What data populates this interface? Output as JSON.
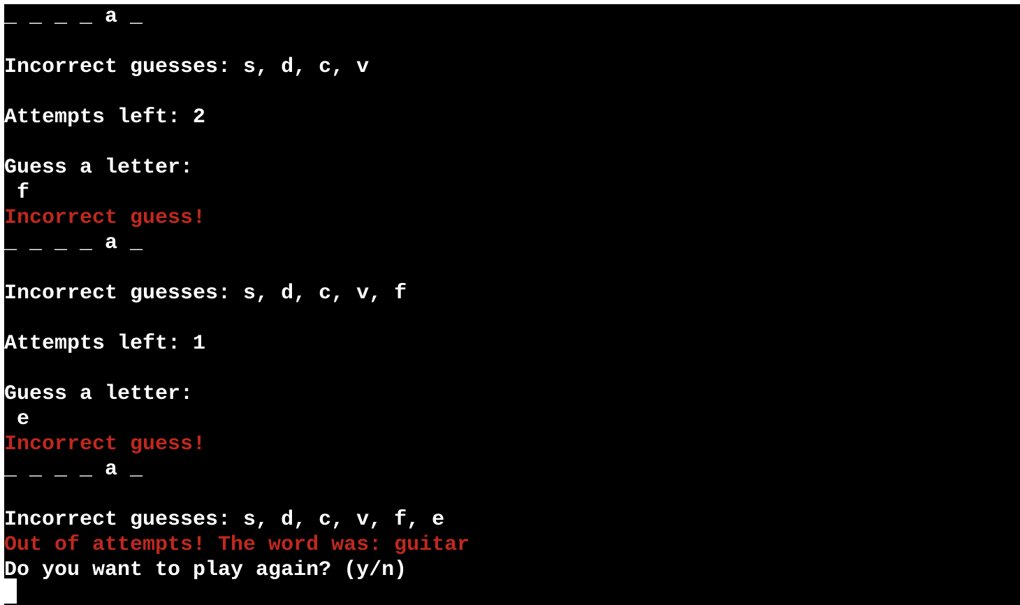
{
  "terminal": {
    "lines": [
      {
        "text": "_ _ _ _ a _",
        "kind": "normal"
      },
      {
        "text": "",
        "kind": "blank"
      },
      {
        "text": "Incorrect guesses: s, d, c, v",
        "kind": "normal"
      },
      {
        "text": "",
        "kind": "blank"
      },
      {
        "text": "Attempts left: 2",
        "kind": "normal"
      },
      {
        "text": "",
        "kind": "blank"
      },
      {
        "text": "Guess a letter:",
        "kind": "normal"
      },
      {
        "text": " f",
        "kind": "input"
      },
      {
        "text": "Incorrect guess!",
        "kind": "error"
      },
      {
        "text": "_ _ _ _ a _",
        "kind": "normal"
      },
      {
        "text": "",
        "kind": "blank"
      },
      {
        "text": "Incorrect guesses: s, d, c, v, f",
        "kind": "normal"
      },
      {
        "text": "",
        "kind": "blank"
      },
      {
        "text": "Attempts left: 1",
        "kind": "normal"
      },
      {
        "text": "",
        "kind": "blank"
      },
      {
        "text": "Guess a letter:",
        "kind": "normal"
      },
      {
        "text": " e",
        "kind": "input"
      },
      {
        "text": "Incorrect guess!",
        "kind": "error"
      },
      {
        "text": "_ _ _ _ a _",
        "kind": "normal"
      },
      {
        "text": "",
        "kind": "blank"
      },
      {
        "text": "Incorrect guesses: s, d, c, v, f, e",
        "kind": "normal"
      },
      {
        "text": "Out of attempts! The word was: guitar",
        "kind": "error"
      },
      {
        "text": "Do you want to play again? (y/n)",
        "kind": "normal"
      }
    ],
    "colors": {
      "background": "#000000",
      "text": "#ffffff",
      "error": "#c0281f",
      "cursor": "#ffffff"
    }
  }
}
